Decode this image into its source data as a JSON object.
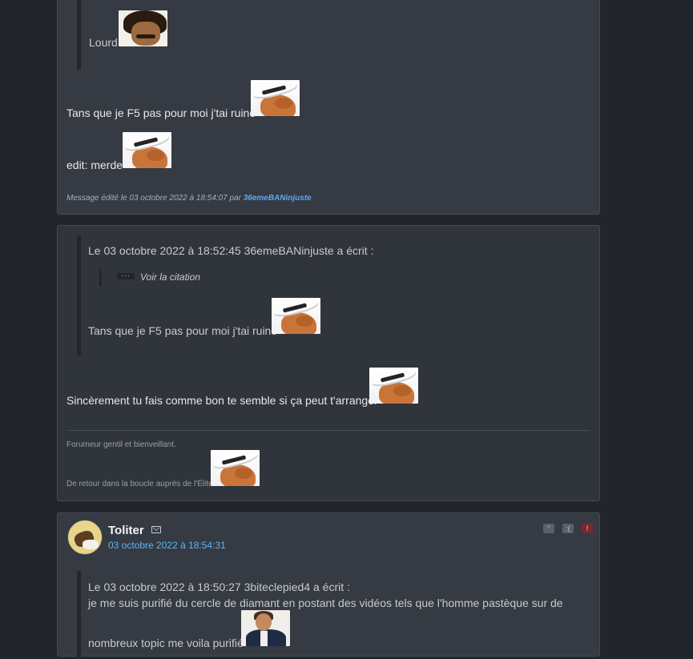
{
  "posts": [
    {
      "quote_text": "Lourd",
      "lines": [
        "Tans que je F5 pas pour moi j'tai ruiné",
        "edit: merde"
      ],
      "edited_prefix": "Message édité le 03 octobre 2022 à 18:54:07 par",
      "edited_user": "36emeBANinjuste"
    },
    {
      "quote_header": "Le 03 octobre 2022 à 18:52:45 36emeBANinjuste a écrit :",
      "show_citation_label": "Voir la citation",
      "toggle_label": "···",
      "quote_text": "Tans que je F5 pas pour moi j'tai ruiné",
      "body": "Sincèrement tu fais comme bon te semble si ça peut t'arranger",
      "signature": [
        "Forumeur gentil et bienveillant.",
        "De retour dans la boucle auprès de l'Élite"
      ]
    },
    {
      "author": "Toliter",
      "date": "03 octobre 2022 à 18:54:31",
      "quote_header": "Le 03 octobre 2022 à 18:50:27 3biteclepied4 a écrit :",
      "quote_line1": "je me suis purifié du cercle de diamant en postant des vidéos tels que l'homme pastèque sur de",
      "quote_line2": "nombreux topic me voila purifié",
      "actions": [
        "quote-icon",
        "sad-icon",
        "alert-icon"
      ],
      "action_glyphs": [
        "\"",
        ":(",
        "!"
      ]
    }
  ],
  "colors": {
    "page_bg": "#22252b",
    "post_bg": "#353a43",
    "link": "#5fa8f0",
    "date": "#5fb4f5",
    "alert": "#7a2a2e"
  }
}
